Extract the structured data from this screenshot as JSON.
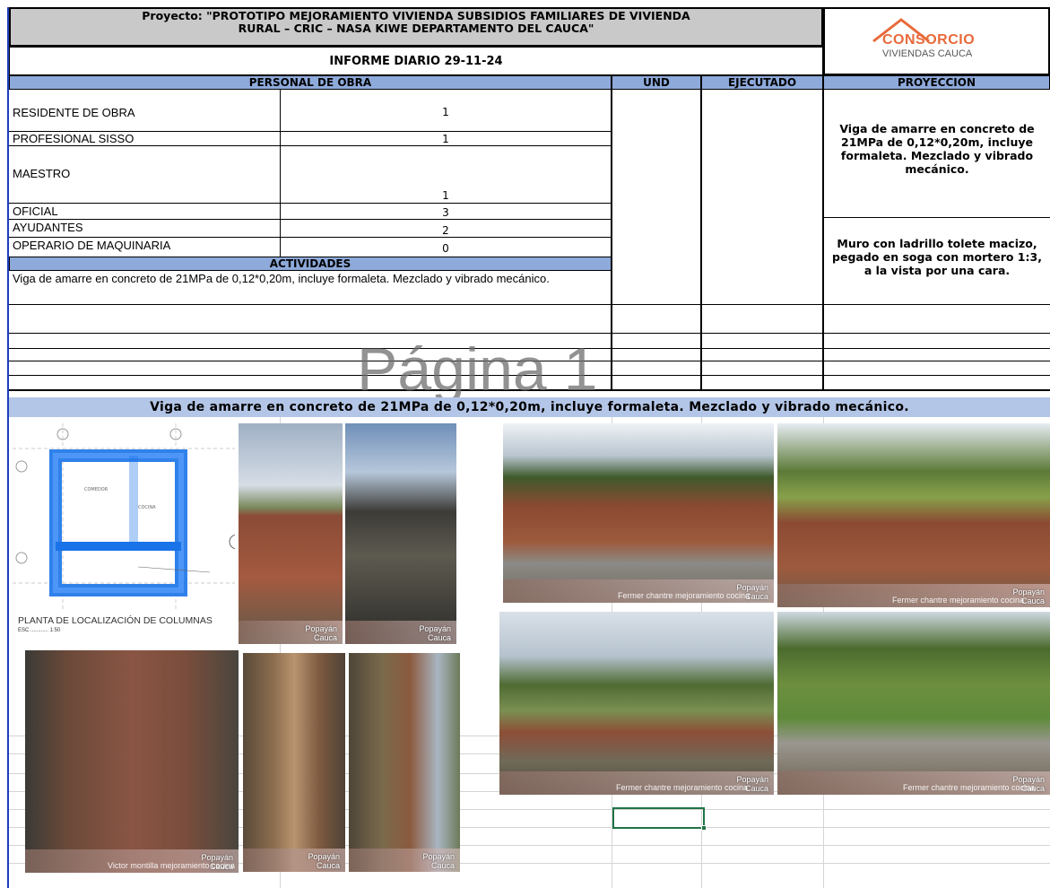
{
  "header": {
    "project_line1": "Proyecto: \"PROTOTIPO MEJORAMIENTO VIVIENDA SUBSIDIOS FAMILIARES DE VIVIENDA",
    "project_line2": "RURAL – CRIC – NASA KIWE DEPARTAMENTO DEL CAUCA\"",
    "informe": "INFORME DIARIO 29-11-24",
    "logo_top": "CONSORCIO",
    "logo_bottom": "VIVIENDAS CAUCA"
  },
  "table": {
    "col_personal": "PERSONAL DE OBRA",
    "col_und": "UND",
    "col_ejecutado": "EJECUTADO",
    "col_proyeccion": "PROYECCION",
    "personal": [
      {
        "role": "RESIDENTE DE OBRA",
        "count": "1"
      },
      {
        "role": "PROFESIONAL SISSO",
        "count": "1"
      },
      {
        "role": "MAESTRO",
        "count": "1"
      },
      {
        "role": "OFICIAL",
        "count": "3"
      },
      {
        "role": "AYUDANTES",
        "count": "2"
      },
      {
        "role": "OPERARIO DE MAQUINARIA",
        "count": "0"
      }
    ],
    "actividades_header": "ACTIVIDADES",
    "actividad_1": "Viga de amarre en concreto de 21MPa de 0,12*0,20m, incluye formaleta. Mezclado y vibrado mecánico.",
    "proyeccion_1": "Viga de amarre en concreto de 21MPa de 0,12*0,20m, incluye formaleta. Mezclado y vibrado mecánico.",
    "proyeccion_2": "Muro con ladrillo tolete macizo, pegado en soga con mortero 1:3, a la vista por una cara."
  },
  "watermark": "Página 1",
  "photos_section": {
    "title": "Viga de amarre en concreto de 21MPa de 0,12*0,20m, incluye formaleta. Mezclado y vibrado mecánico.",
    "plan_caption": "PLANTA DE LOCALIZACIÓN DE COLUMNAS",
    "plan_scale": "ESC ............ 1:50",
    "photo_place_line1": "Popayán",
    "photo_place_line2": "Cauca",
    "photo_caption_a": "Fermer chantre mejoramiento cocina",
    "photo_caption_b": "Victor montilla mejoramiento cocina"
  }
}
